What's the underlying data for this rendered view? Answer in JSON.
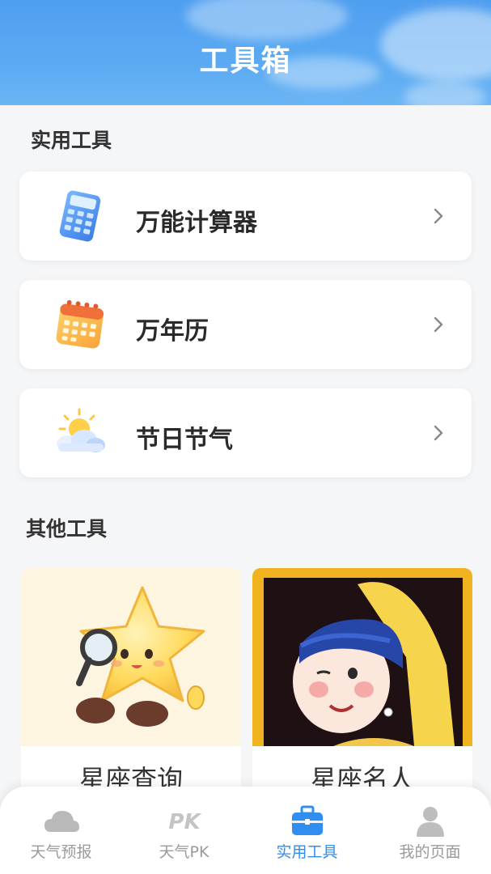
{
  "header": {
    "title": "工具箱"
  },
  "practical": {
    "title": "实用工具",
    "items": [
      {
        "label": "万能计算器",
        "icon": "calculator-icon"
      },
      {
        "label": "万年历",
        "icon": "calendar-icon"
      },
      {
        "label": "节日节气",
        "icon": "sun-cloud-icon"
      }
    ]
  },
  "other": {
    "title": "其他工具",
    "cards": [
      {
        "label": "星座查询",
        "image": "star-magnifier-illustration"
      },
      {
        "label": "星座名人",
        "image": "girl-with-pearl-earring-illustration"
      }
    ]
  },
  "tabs": [
    {
      "label": "天气预报",
      "icon": "cloud-icon",
      "active": false
    },
    {
      "label": "天气PK",
      "icon": "pk-icon",
      "active": false
    },
    {
      "label": "实用工具",
      "icon": "toolbox-icon",
      "active": true
    },
    {
      "label": "我的页面",
      "icon": "user-icon",
      "active": false
    }
  ],
  "colors": {
    "accent": "#2f8ef0",
    "header": "#4f9ff0",
    "inactive": "#9a9a9a"
  }
}
